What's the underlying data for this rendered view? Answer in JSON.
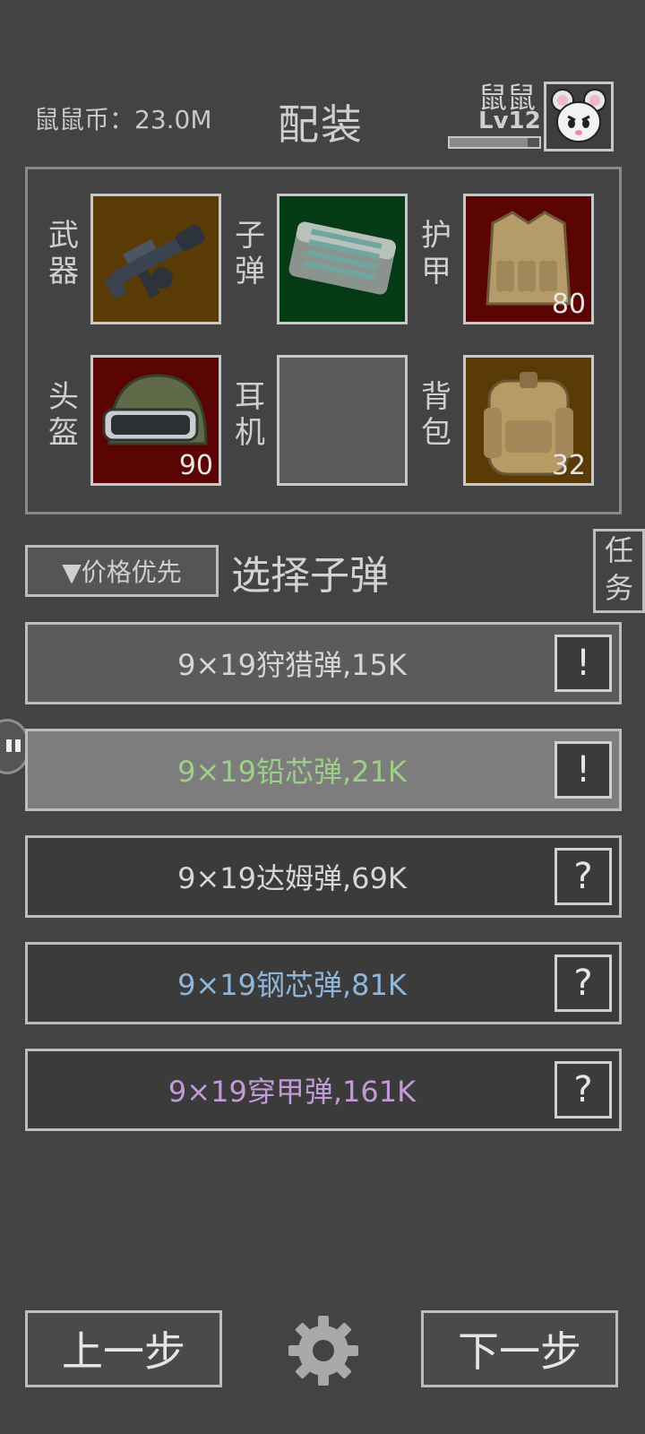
{
  "header": {
    "coins": "鼠鼠币：23.0M",
    "title": "配装",
    "player_name": "鼠鼠",
    "player_level": "Lv12",
    "xp_fraction": 0.87
  },
  "loadout": {
    "slots": [
      {
        "label": "武器",
        "icon": "gun-icon",
        "color": "#5a3b05",
        "count": ""
      },
      {
        "label": "子弹",
        "icon": "ammo-box-icon",
        "color": "#053b14",
        "count": ""
      },
      {
        "label": "护甲",
        "icon": "armor-vest-icon",
        "color": "#5a0404",
        "count": "80"
      },
      {
        "label": "头盔",
        "icon": "helmet-icon",
        "color": "#5a0404",
        "count": "90"
      },
      {
        "label": "耳机",
        "icon": "",
        "color": "#5a5a5a",
        "count": ""
      },
      {
        "label": "背包",
        "icon": "backpack-icon",
        "color": "#5a3b05",
        "count": "32"
      }
    ]
  },
  "sort_button": "▼价格优先",
  "section_title": "选择子弹",
  "task_button": "任务",
  "ammo_list": [
    {
      "label": "9×19狩猎弹,15K",
      "info": "!",
      "color": "#d6d6d6",
      "bg": "#5b5b5b"
    },
    {
      "label": "9×19铅芯弹,21K",
      "info": "!",
      "color": "#9ccf8a",
      "bg": "#7d7d7d"
    },
    {
      "label": "9×19达姆弹,69K",
      "info": "?",
      "color": "#d6d6d6",
      "bg": "#3b3b3b"
    },
    {
      "label": "9×19钢芯弹,81K",
      "info": "?",
      "color": "#8fb6db",
      "bg": "#3b3b3b"
    },
    {
      "label": "9×19穿甲弹,161K",
      "info": "?",
      "color": "#c39ad8",
      "bg": "#3b3b3b"
    }
  ],
  "footer": {
    "prev": "上一步",
    "next": "下一步"
  }
}
